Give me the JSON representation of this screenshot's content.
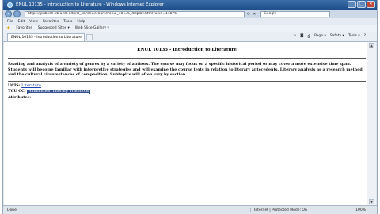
{
  "window": {
    "title": "ENUL 10135 - Introduction to Literature - Windows Internet Explorer",
    "buttons": [
      "_",
      "□",
      "✕"
    ]
  },
  "address_bar": {
    "url": "https://publish.lib.ucdl.edu/cl_ssl/enui/course/enul_10135_display.html?ucid=14875",
    "search_placeholder": "Google"
  },
  "menu": [
    "File",
    "Edit",
    "View",
    "Favorites",
    "Tools",
    "Help"
  ],
  "favorites_bar": {
    "label": "Favorites",
    "items": [
      "Suggested Sites ▾",
      "Web Slice Gallery ▾"
    ]
  },
  "tab": {
    "label": "ENUL 10135 - Introduction to Literature"
  },
  "command_bar": [
    "Page ▾",
    "Safety ▾",
    "Tools ▾",
    "?"
  ],
  "page": {
    "course_title": "ENUL 10135 - Introduction to Literature",
    "description": "Reading and analysis of a variety of genres by a variety of authors. The course may focus on a specific historical period or may cover a more extensive time span. Students will become familiar with interpretive strategies and will examine the course texts in relation to literary antecedents. Literary analysis as a research method, and the cultural circumstances of composition. Subtopics will often vary by section.",
    "ucis_label": "UCIS:",
    "ucis_value": "Literature",
    "tcu_label": "TCU CC:",
    "tcu_value": "Humanities: Literary Traditions",
    "attributes_label": "Attributes:"
  },
  "status_bar": {
    "text": "Done",
    "zone": "Internet | Protected Mode: On",
    "zoom": "100%"
  }
}
